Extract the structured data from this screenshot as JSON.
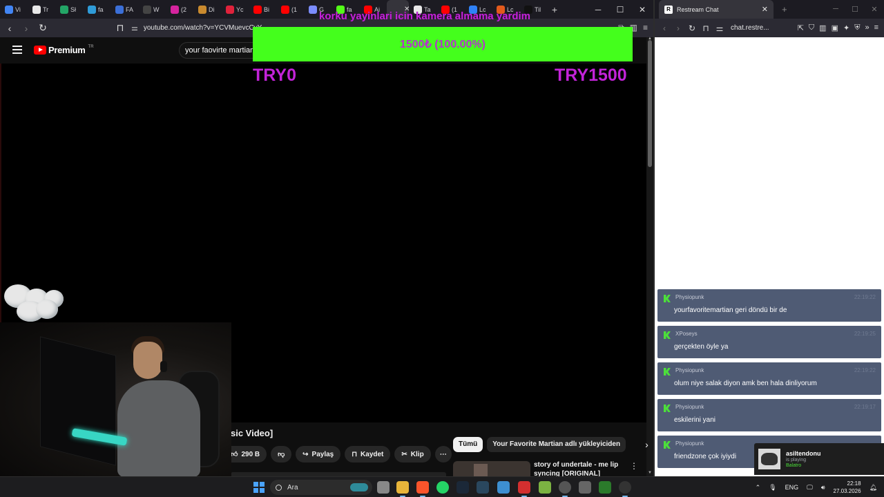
{
  "overlay": {
    "donation_header": "korku yayinlari icin kamera almama yardim",
    "goal_progress_text": "1500₺ (100.00%)",
    "goal_progress_fraction": 1.0,
    "goal_min": "TRY0",
    "goal_max": "TRY1500",
    "bar_color": "#44ff1c",
    "text_color": "#c223d8"
  },
  "main_browser": {
    "tabs": [
      {
        "label": "Vi",
        "icon": "chrome-icon",
        "color": "#4285f4"
      },
      {
        "label": "Tr",
        "icon": "app-icon",
        "color": "#e8e8e8"
      },
      {
        "label": "Sł",
        "icon": "sheets-icon",
        "color": "#23a566"
      },
      {
        "label": "fa",
        "icon": "l-icon",
        "color": "#2f9bd8"
      },
      {
        "label": "FA",
        "icon": "r-icon",
        "color": "#3b6fd8"
      },
      {
        "label": "W",
        "icon": "circle-icon",
        "color": "#444"
      },
      {
        "label": "(2",
        "icon": "instagram-icon",
        "color": "#d6249f"
      },
      {
        "label": "Di",
        "icon": "drop-icon",
        "color": "#c98a2e"
      },
      {
        "label": "Yc",
        "icon": "youtube-icon",
        "color": "#e0223b"
      },
      {
        "label": "Bi",
        "icon": "youtube-icon",
        "color": "#ff0000"
      },
      {
        "label": "(1",
        "icon": "youtube-icon",
        "color": "#ff0000"
      },
      {
        "label": "G",
        "icon": "gemini-icon",
        "color": "#7b8cff"
      },
      {
        "label": "fa",
        "icon": "kick-icon",
        "color": "#53fc18"
      },
      {
        "label": "Ai",
        "icon": "youtube-icon",
        "color": "#ff0000"
      },
      {
        "label": "",
        "icon": "speaker-icon",
        "color": "#35343b",
        "active": true
      },
      {
        "label": "Ta",
        "icon": "bolt-icon",
        "color": "#e8e8e8"
      },
      {
        "label": "(1",
        "icon": "youtube-icon",
        "color": "#ff0000"
      },
      {
        "label": "Lc",
        "icon": "check-icon",
        "color": "#2f81f7"
      },
      {
        "label": "Lc",
        "icon": "l-circle-icon",
        "color": "#e25a1c"
      },
      {
        "label": "Til",
        "icon": "tiktok-icon",
        "color": "#111"
      }
    ],
    "url": "youtube.com/watch?v=YCVMuevcCvY",
    "yt": {
      "brand": "Premium",
      "country": "TR",
      "search_value": "your faovirte martian",
      "video_title_fragment": "sic Video]",
      "like_count": "290 B",
      "share_label": "Paylaş",
      "save_label": "Kaydet",
      "clip_label": "Klip",
      "chips": [
        "Tümü",
        "Your Favorite Martian adlı yükleyiciden"
      ],
      "recommendation_title": "story of undertale - me lip syncing [ORIGINAL]"
    }
  },
  "chat_browser": {
    "tab_title": "Restream Chat",
    "url": "chat.restre...",
    "messages": [
      {
        "user": "Physiopunk",
        "time": "22:19:22",
        "text": "yourfavoritemartian geri döndü bir de"
      },
      {
        "user": "XPoseys",
        "time": "22:19:25",
        "text": "gerçekten öyle ya"
      },
      {
        "user": "Physiopunk",
        "time": "22:19:22",
        "text": "olum niye salak diyon amk ben hala dinliyorum"
      },
      {
        "user": "Physiopunk",
        "time": "22:19:17",
        "text": "eskilerini yani"
      },
      {
        "user": "Physiopunk",
        "time": "",
        "text": "friendzone çok iyiydi"
      }
    ],
    "platform_color": "#4ce03a",
    "message_bg": "#4f5b74"
  },
  "now_playing": {
    "name": "asiltendonu",
    "status": "is playing",
    "game": "Balatro"
  },
  "taskbar": {
    "search_placeholder": "Ara",
    "language": "ENG",
    "time": "22:18",
    "date": "27.03.2026"
  }
}
